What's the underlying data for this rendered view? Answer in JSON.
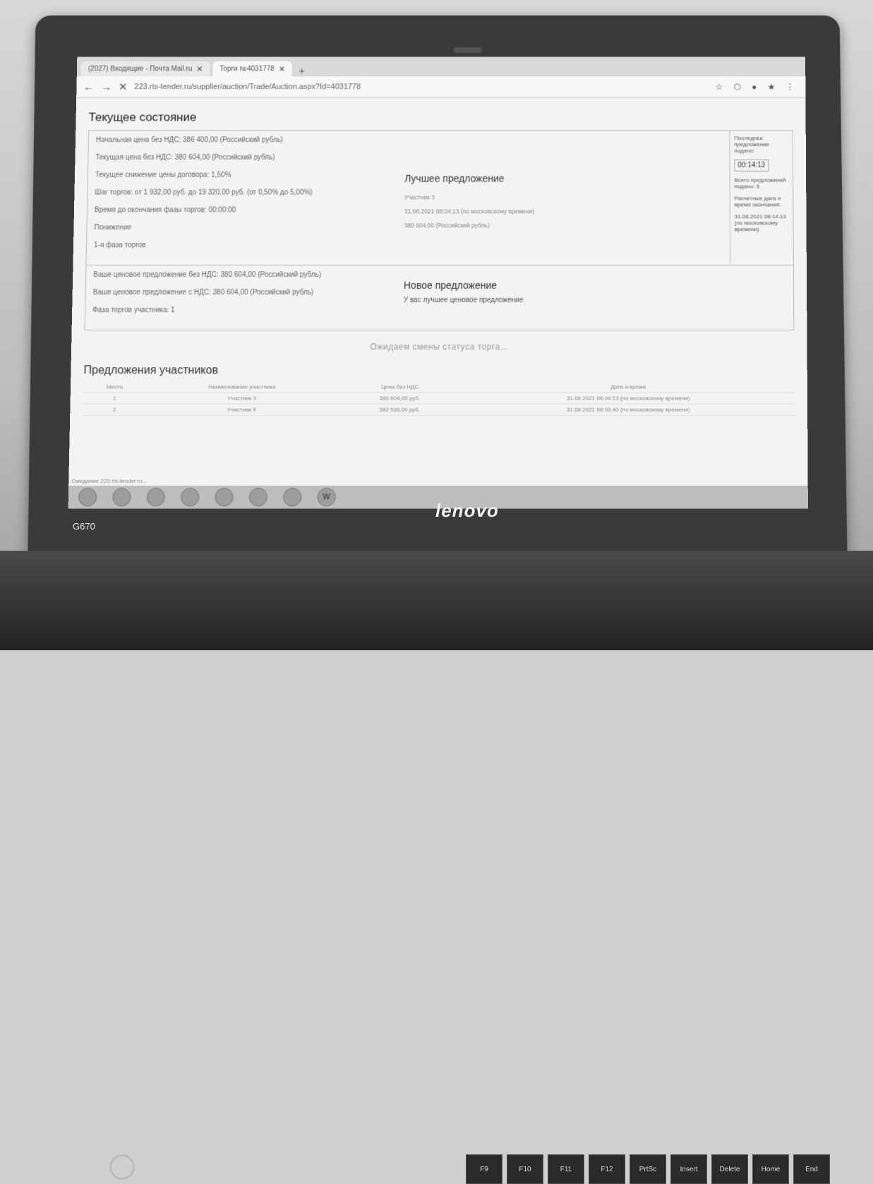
{
  "device": {
    "model": "G670",
    "brand": "lenovo"
  },
  "browser": {
    "tabs": [
      {
        "label": "(2027) Входящие - Почта Mail.ru",
        "close": "✕"
      },
      {
        "label": "Торги №4031778",
        "close": "✕"
      }
    ],
    "new_tab": "+",
    "back": "←",
    "forward": "→",
    "stop": "✕",
    "url": "223.rts-tender.ru/supplier/auction/Trade/Auction.aspx?Id=4031778",
    "toolbar_icons": "☆ ⬡ ● ★ ⋮"
  },
  "current_state": {
    "title": "Текущее состояние",
    "start_price": "Начальная цена без НДС: 386 400,00 (Российский рубль)",
    "current_price": "Текущая цена без НДС: 380 604,00 (Российский рубль)",
    "reduction": "Текущее снижение цены договора: 1,50%",
    "step": "Шаг торгов: от 1 932,00 руб. до 19 320,00 руб. (от 0,50% до 5,00%)",
    "time_left": "Время до окончания фазы торгов: 00:00:00",
    "extension": "Понижение",
    "phase": "1-я фаза торгов"
  },
  "best_offer": {
    "title": "Лучшее предложение",
    "participant": "Участник 3",
    "datetime": "31.08.2021 08:04:13 (по московскому времени)",
    "price": "380 604,00 (Российский рубль)"
  },
  "side_info": {
    "last_offer_label": "Последнее предложение подано:",
    "timer": "00:14:13",
    "total_label": "Всего предложений подано: 3",
    "calc_label": "Расчетные дата и время окончания:",
    "calc_value": "31.08.2021 08:14:13 (по московскому времени)"
  },
  "your_offer": {
    "without_vat": "Ваше ценовое предложение без НДС: 380 604,00 (Российский рубль)",
    "with_vat": "Ваше ценовое предложение с НДС: 380 604,00 (Российский рубль)",
    "phase_label": "Фаза торгов участника: 1"
  },
  "new_offer": {
    "title": "Новое предложение",
    "message": "У вас лучшее ценовое предложение"
  },
  "waiting": "Ожидаем смены статуса торга...",
  "offers": {
    "title": "Предложения участников",
    "columns": [
      "Место",
      "Наименование участника",
      "Цена без НДС",
      "Дата и время"
    ],
    "rows": [
      [
        "1",
        "Участник 3",
        "380 604,00 руб.",
        "31.08.2021 08:04:13 (по московскому времени)"
      ],
      [
        "2",
        "Участник 4",
        "382 536,00 руб.",
        "31.08.2021 08:03:40 (по московскому времени)"
      ]
    ]
  },
  "status_bar": "Ожидание 223.rts-tender.ru...",
  "taskbar_word": "W"
}
